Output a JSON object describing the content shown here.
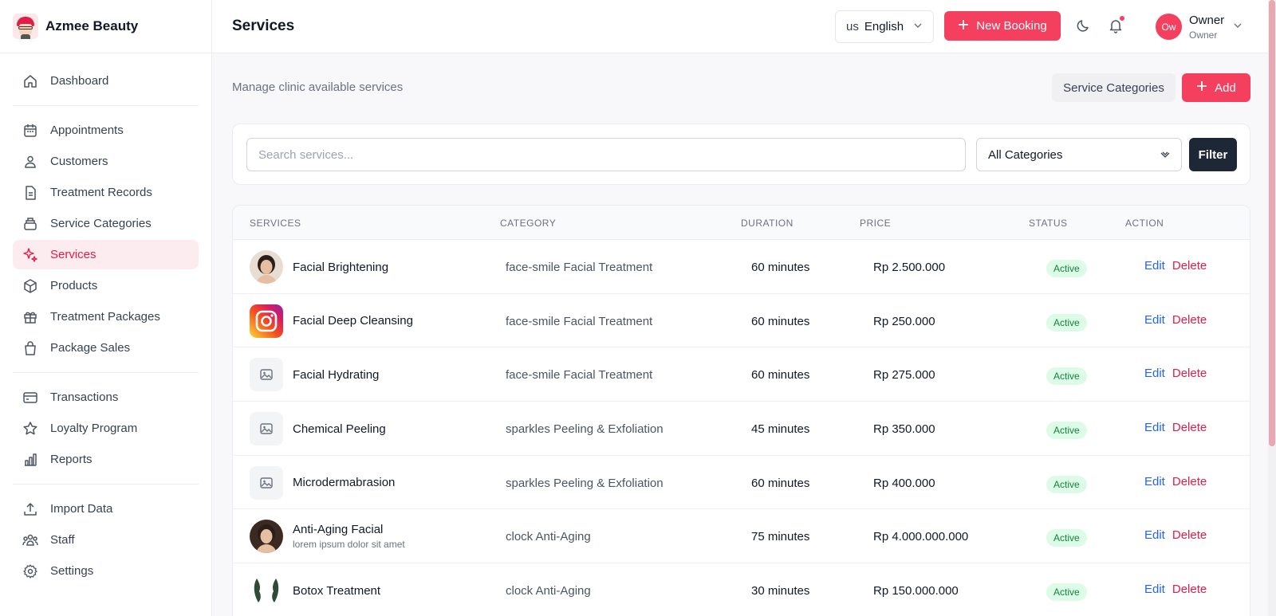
{
  "brand": {
    "name": "Azmee Beauty"
  },
  "sidebar": {
    "groups": [
      [
        {
          "label": "Dashboard",
          "icon": "home-icon"
        }
      ],
      [
        {
          "label": "Appointments",
          "icon": "calendar-icon"
        },
        {
          "label": "Customers",
          "icon": "users-icon"
        },
        {
          "label": "Treatment Records",
          "icon": "file-icon"
        },
        {
          "label": "Service Categories",
          "icon": "layers-icon"
        },
        {
          "label": "Services",
          "icon": "sparkles-icon",
          "active": true
        },
        {
          "label": "Products",
          "icon": "box-icon"
        },
        {
          "label": "Treatment Packages",
          "icon": "gift-icon"
        },
        {
          "label": "Package Sales",
          "icon": "shopping-bag-icon"
        }
      ],
      [
        {
          "label": "Transactions",
          "icon": "credit-card-icon"
        },
        {
          "label": "Loyalty Program",
          "icon": "star-icon"
        },
        {
          "label": "Reports",
          "icon": "bar-chart-icon"
        }
      ],
      [
        {
          "label": "Import Data",
          "icon": "upload-icon"
        },
        {
          "label": "Staff",
          "icon": "team-icon"
        },
        {
          "label": "Settings",
          "icon": "gear-icon"
        }
      ]
    ]
  },
  "header": {
    "title": "Services",
    "language_code": "us",
    "language": "English",
    "new_booking": "New Booking",
    "user_initials": "Ow",
    "user_name": "Owner",
    "user_role": "Owner"
  },
  "main": {
    "subtitle": "Manage clinic available services",
    "service_categories_button": "Service Categories",
    "add_button": "Add",
    "search_placeholder": "Search services...",
    "category_filter": "All Categories",
    "filter_button": "Filter"
  },
  "table": {
    "columns": [
      "SERVICES",
      "CATEGORY",
      "DURATION",
      "PRICE",
      "STATUS",
      "ACTION"
    ],
    "rows": [
      {
        "name": "Facial Brightening",
        "desc": "",
        "category": "face-smile Facial Treatment",
        "duration": "60 minutes",
        "price": "Rp 2.500.000",
        "status": "Active",
        "thumb": "portrait-woman"
      },
      {
        "name": "Facial Deep Cleansing",
        "desc": "",
        "category": "face-smile Facial Treatment",
        "duration": "60 minutes",
        "price": "Rp 250.000",
        "status": "Active",
        "thumb": "instagram-logo"
      },
      {
        "name": "Facial Hydrating",
        "desc": "",
        "category": "face-smile Facial Treatment",
        "duration": "60 minutes",
        "price": "Rp 275.000",
        "status": "Active",
        "thumb": "image-placeholder"
      },
      {
        "name": "Chemical Peeling",
        "desc": "",
        "category": "sparkles Peeling & Exfoliation",
        "duration": "45 minutes",
        "price": "Rp 350.000",
        "status": "Active",
        "thumb": "image-placeholder"
      },
      {
        "name": "Microdermabrasion",
        "desc": "",
        "category": "sparkles Peeling & Exfoliation",
        "duration": "60 minutes",
        "price": "Rp 400.000",
        "status": "Active",
        "thumb": "image-placeholder"
      },
      {
        "name": "Anti-Aging Facial",
        "desc": "lorem ipsum dolor sit amet",
        "category": "clock Anti-Aging",
        "duration": "75 minutes",
        "price": "Rp 4.000.000.000",
        "status": "Active",
        "thumb": "portrait-woman-2"
      },
      {
        "name": "Botox Treatment",
        "desc": "",
        "category": "clock Anti-Aging",
        "duration": "30 minutes",
        "price": "Rp 150.000.000",
        "status": "Active",
        "thumb": "green-leaf-logo"
      }
    ],
    "edit_label": "Edit",
    "delete_label": "Delete"
  },
  "colors": {
    "accent": "#f43f5e",
    "dark_button": "#1e2736",
    "active_badge_bg": "#dcfce7",
    "active_badge_text": "#15803d",
    "edit_link": "#2563eb",
    "delete_link": "#e11d48"
  }
}
